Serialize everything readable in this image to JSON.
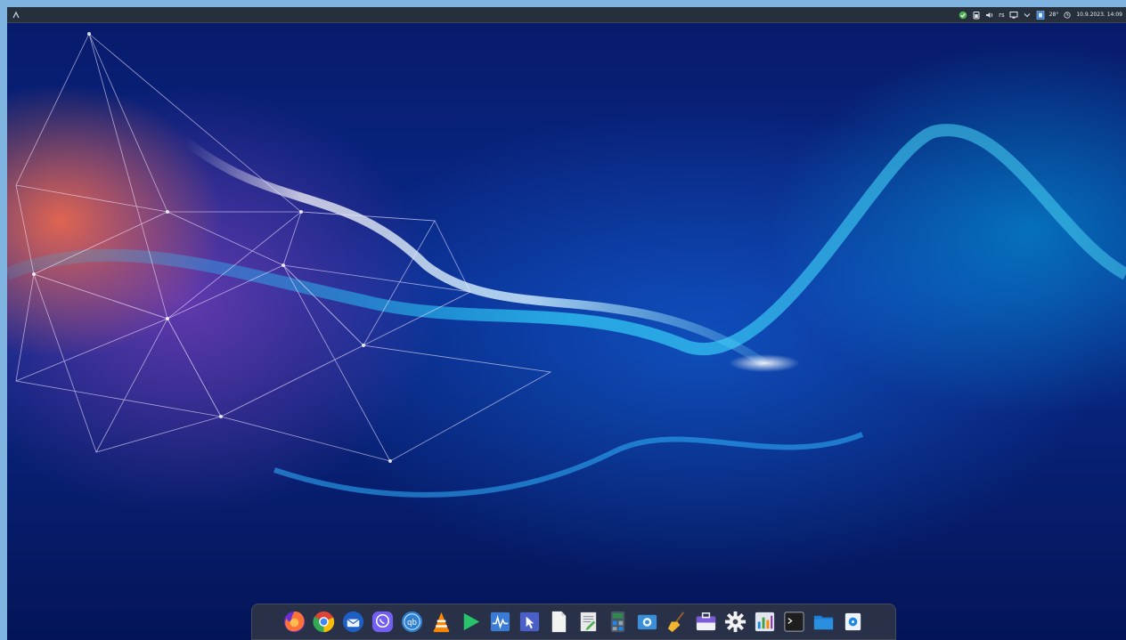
{
  "topbar": {
    "launcher_icon": "app-menu-icon",
    "tray_icons": [
      "update-check-icon",
      "battery-icon",
      "volume-icon"
    ],
    "keyboard_layout": "rs",
    "tray_icons_2": [
      "network-icon",
      "chevron-down-icon",
      "clipboard-icon"
    ],
    "weather": "28°",
    "datetime": "10.9.2023. 14:09"
  },
  "dock": {
    "items": [
      {
        "name": "firefox",
        "icon": "firefox-icon",
        "color": "#ff7139"
      },
      {
        "name": "chrome",
        "icon": "chrome-icon",
        "color": "#34a853"
      },
      {
        "name": "thunderbird",
        "icon": "mail-icon",
        "color": "#3a8ee6"
      },
      {
        "name": "viber",
        "icon": "viber-icon",
        "color": "#7360f2"
      },
      {
        "name": "qbittorrent",
        "icon": "qbittorrent-icon",
        "color": "#2f80d1"
      },
      {
        "name": "vlc",
        "icon": "vlc-icon",
        "color": "#ff8800"
      },
      {
        "name": "media-player",
        "icon": "play-icon",
        "color": "#27c46b"
      },
      {
        "name": "system-monitor",
        "icon": "monitor-icon",
        "color": "#3a7bd5"
      },
      {
        "name": "screenshot-tool",
        "icon": "pointer-icon",
        "color": "#5b6fd6"
      },
      {
        "name": "text-document",
        "icon": "document-icon",
        "color": "#f1f1f1"
      },
      {
        "name": "text-editor",
        "icon": "editor-icon",
        "color": "#e9e9e9"
      },
      {
        "name": "calculator",
        "icon": "calculator-icon",
        "color": "#4a5568"
      },
      {
        "name": "camera",
        "icon": "camera-icon",
        "color": "#3b8fd9"
      },
      {
        "name": "cleaner",
        "icon": "broom-icon",
        "color": "#f2b632"
      },
      {
        "name": "toolbox",
        "icon": "briefcase-icon",
        "color": "#7b5bd6"
      },
      {
        "name": "settings",
        "icon": "gear-icon",
        "color": "#f2f2f2"
      },
      {
        "name": "system-info",
        "icon": "dashboard-icon",
        "color": "#dfe6ee"
      },
      {
        "name": "terminal",
        "icon": "terminal-icon",
        "color": "#1e1e1e"
      },
      {
        "name": "file-manager",
        "icon": "folder-icon",
        "color": "#2b8fe0"
      },
      {
        "name": "disk-utility",
        "icon": "disk-icon",
        "color": "#eef3f8"
      }
    ]
  }
}
